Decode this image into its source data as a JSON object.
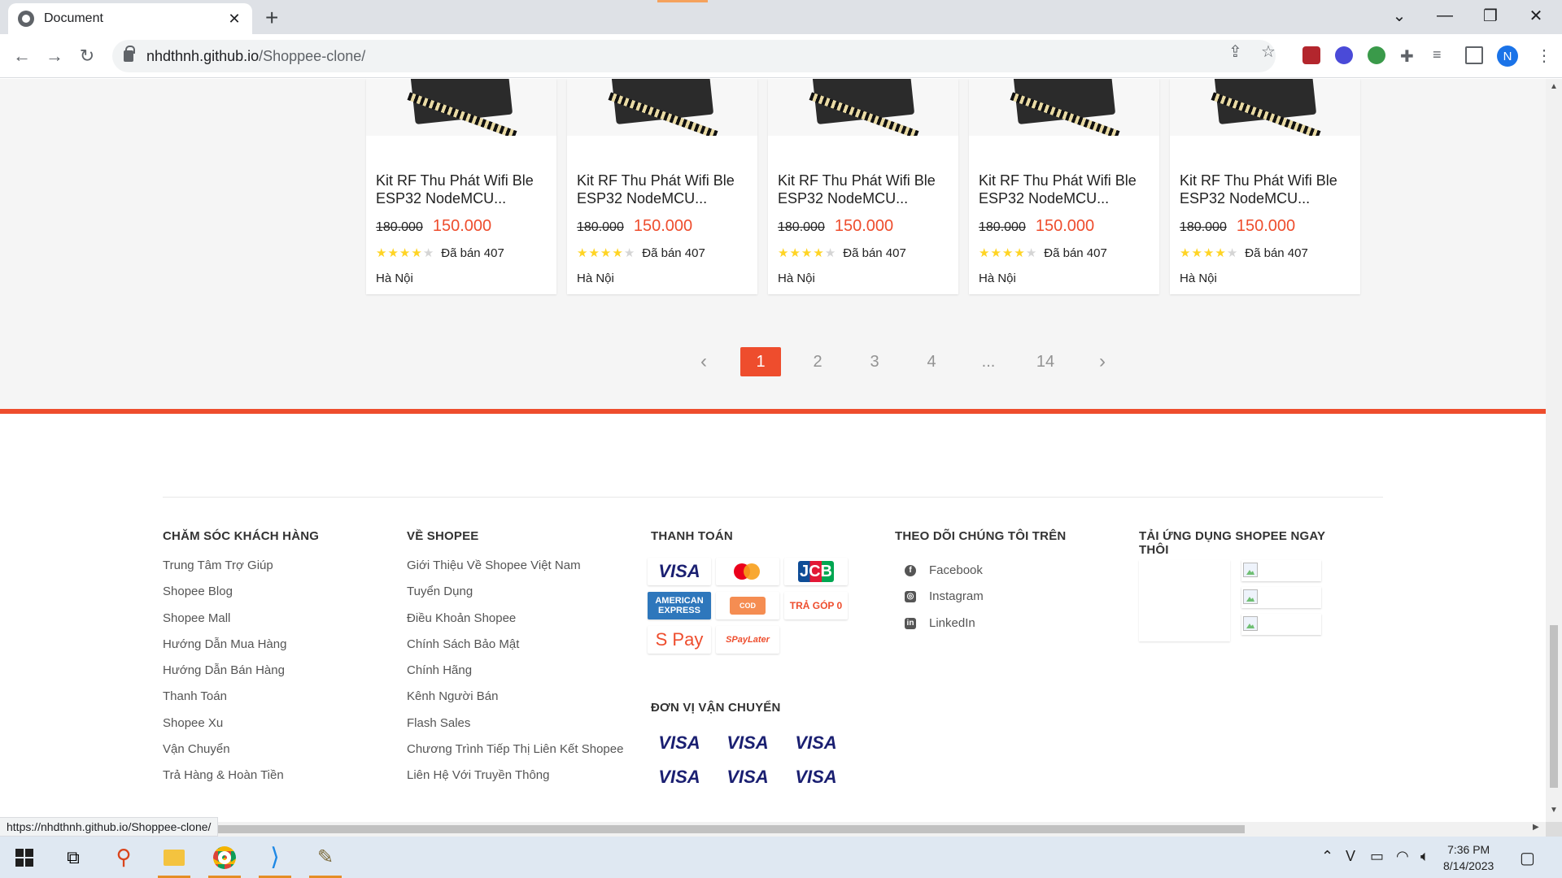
{
  "browser": {
    "tab_title": "Document",
    "url_host": "nhdthnh.github.io",
    "url_path": "/Shoppee-clone/",
    "status_url": "https://nhdthnh.github.io/Shoppee-clone/",
    "profile_initial": "N"
  },
  "products": [
    {
      "name": "Kit RF Thu Phát Wifi Ble ESP32 NodeMCU...",
      "old_price": "180.000",
      "new_price": "150.000",
      "rating": 4,
      "sold": "Đã bán 407",
      "location": "Hà Nội"
    },
    {
      "name": "Kit RF Thu Phát Wifi Ble ESP32 NodeMCU...",
      "old_price": "180.000",
      "new_price": "150.000",
      "rating": 4,
      "sold": "Đã bán 407",
      "location": "Hà Nội"
    },
    {
      "name": "Kit RF Thu Phát Wifi Ble ESP32 NodeMCU...",
      "old_price": "180.000",
      "new_price": "150.000",
      "rating": 4,
      "sold": "Đã bán 407",
      "location": "Hà Nội"
    },
    {
      "name": "Kit RF Thu Phát Wifi Ble ESP32 NodeMCU...",
      "old_price": "180.000",
      "new_price": "150.000",
      "rating": 4,
      "sold": "Đã bán 407",
      "location": "Hà Nội"
    },
    {
      "name": "Kit RF Thu Phát Wifi Ble ESP32 NodeMCU...",
      "old_price": "180.000",
      "new_price": "150.000",
      "rating": 4,
      "sold": "Đã bán 407",
      "location": "Hà Nội"
    }
  ],
  "pagination": {
    "prev": "‹",
    "next": "›",
    "pages": [
      "1",
      "2",
      "3",
      "4",
      "...",
      "14"
    ],
    "active": "1"
  },
  "footer": {
    "customer_care": {
      "title": "CHĂM SÓC KHÁCH HÀNG",
      "items": [
        "Trung Tâm Trợ Giúp",
        "Shopee Blog",
        "Shopee Mall",
        "Hướng Dẫn Mua Hàng",
        "Hướng Dẫn Bán Hàng",
        "Thanh Toán",
        "Shopee Xu",
        "Vận Chuyển",
        "Trả Hàng & Hoàn Tiền"
      ]
    },
    "about": {
      "title": "VỀ SHOPEE",
      "items": [
        "Giới Thiệu Về Shopee Việt Nam",
        "Tuyển Dụng",
        "Điều Khoản Shopee",
        "Chính Sách Bảo Mật",
        "Chính Hãng",
        "Kênh Người Bán",
        "Flash Sales",
        "Chương Trình Tiếp Thị Liên Kết Shopee",
        "Liên Hệ Với Truyền Thông"
      ]
    },
    "payment": {
      "title": "THANH TOÁN",
      "logos": {
        "visa": "VISA",
        "jcb": "JCB",
        "amex": "AMERICAN EXPRESS",
        "cod": "COD",
        "tragop": "TRẢ GÓP 0",
        "spay": "S Pay",
        "spaylater": "SPayLater"
      }
    },
    "shipping": {
      "title": "ĐƠN VỊ VẬN CHUYỂN",
      "logo": "VISA"
    },
    "follow": {
      "title": "THEO DÕI CHÚNG TÔI TRÊN",
      "items": [
        "Facebook",
        "Instagram",
        "LinkedIn"
      ]
    },
    "app": {
      "title": "TẢI ỨNG DỤNG SHOPEE NGAY THÔI"
    }
  },
  "taskbar": {
    "time": "7:36 PM",
    "date": "8/14/2023"
  },
  "colors": {
    "brand": "#ee4d2d",
    "star": "#ffd424"
  }
}
